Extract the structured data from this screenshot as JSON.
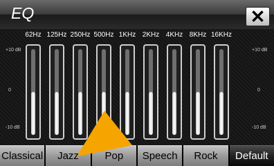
{
  "window": {
    "title": "EQ",
    "close_glyph": "✕"
  },
  "scale": {
    "max_label": "+10 dB",
    "mid_label": "0",
    "min_label": "-10 dB"
  },
  "bands": [
    {
      "freq": "62Hz",
      "level_db": 0
    },
    {
      "freq": "125Hz",
      "level_db": 0
    },
    {
      "freq": "250Hz",
      "level_db": 0
    },
    {
      "freq": "500Hz",
      "level_db": 0
    },
    {
      "freq": "1KHz",
      "level_db": 0
    },
    {
      "freq": "2KHz",
      "level_db": 0
    },
    {
      "freq": "4KHz",
      "level_db": 0
    },
    {
      "freq": "8KHz",
      "level_db": 0
    },
    {
      "freq": "16KHz",
      "level_db": 0
    }
  ],
  "presets": [
    "Classical",
    "Jazz",
    "Pop",
    "Speech",
    "Rock",
    "Default"
  ],
  "selected_preset": "Default",
  "colors": {
    "pointer": "#f5a400",
    "active_preset_bg": "#111111"
  },
  "icons": {
    "close": "close-icon",
    "pointer": "pointer-arrow-icon"
  }
}
